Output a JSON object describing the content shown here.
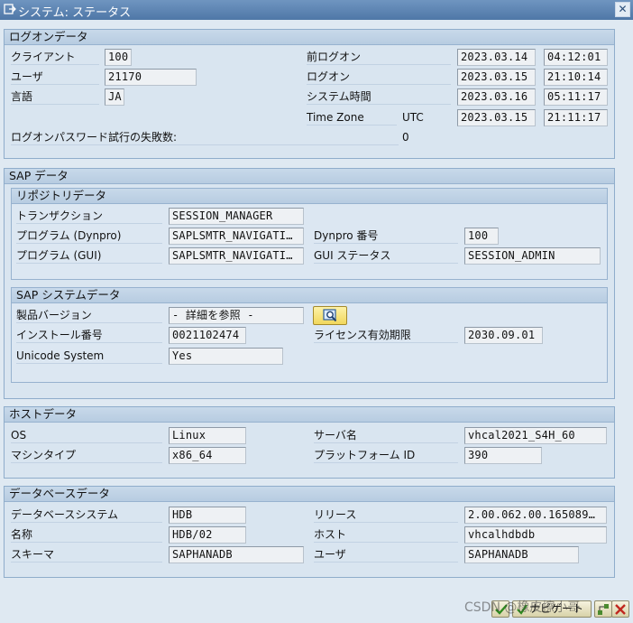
{
  "window": {
    "title": "システム: ステータス",
    "close_symbol": "✕"
  },
  "logon": {
    "header": "ログオンデータ",
    "client_label": "クライアント",
    "client_value": "100",
    "user_label": "ユーザ",
    "user_value": "21170",
    "language_label": "言語",
    "language_value": "JA",
    "prev_logon_label": "前ログオン",
    "prev_logon_date": "2023.03.14",
    "prev_logon_time": "04:12:01",
    "logon_label": "ログオン",
    "logon_date": "2023.03.15",
    "logon_time": "21:10:14",
    "system_time_label": "システム時間",
    "system_date": "2023.03.16",
    "system_time": "05:11:17",
    "timezone_label": "Time Zone",
    "timezone_value": "UTC",
    "tz_date": "2023.03.15",
    "tz_time": "21:11:17",
    "failed_label": "ログオンパスワード試行の失敗数:",
    "failed_value": "0"
  },
  "sap": {
    "header": "SAP データ",
    "repo": {
      "header": "リポジトリデータ",
      "transaction_label": "トランザクション",
      "transaction_value": "SESSION_MANAGER",
      "program_dynpro_label": "プログラム (Dynpro)",
      "program_dynpro_value": "SAPLSMTR_NAVIGATI…",
      "dynpro_no_label": "Dynpro 番号",
      "dynpro_no_value": "100",
      "program_gui_label": "プログラム (GUI)",
      "program_gui_value": "SAPLSMTR_NAVIGATI…",
      "gui_status_label": "GUI ステータス",
      "gui_status_value": "SESSION_ADMIN"
    },
    "system": {
      "header": "SAP システムデータ",
      "product_version_label": "製品バージョン",
      "product_version_value": "- 詳細を参照 -",
      "install_no_label": "インストール番号",
      "install_no_value": "0021102474",
      "license_label": "ライセンス有効期限",
      "license_value": "2030.09.01",
      "unicode_label": "Unicode System",
      "unicode_value": "Yes"
    }
  },
  "host": {
    "header": "ホストデータ",
    "os_label": "OS",
    "os_value": "Linux",
    "server_label": "サーバ名",
    "server_value": "vhcal2021_S4H_60",
    "machine_label": "マシンタイプ",
    "machine_value": "x86_64",
    "platform_label": "プラットフォーム ID",
    "platform_value": "390"
  },
  "db": {
    "header": "データベースデータ",
    "system_label": "データベースシステム",
    "system_value": "HDB",
    "release_label": "リリース",
    "release_value": "2.00.062.00.165089…",
    "name_label": "名称",
    "name_value": "HDB/02",
    "host_label": "ホスト",
    "host_value": "vhcalhdbdb",
    "schema_label": "スキーマ",
    "schema_value": "SAPHANADB",
    "user_label": "ユーザ",
    "user_value": "SAPHANADB"
  },
  "footer": {
    "navigate_label": "ナビゲート",
    "watermark": "CSDN @橡皮擦小哥"
  }
}
